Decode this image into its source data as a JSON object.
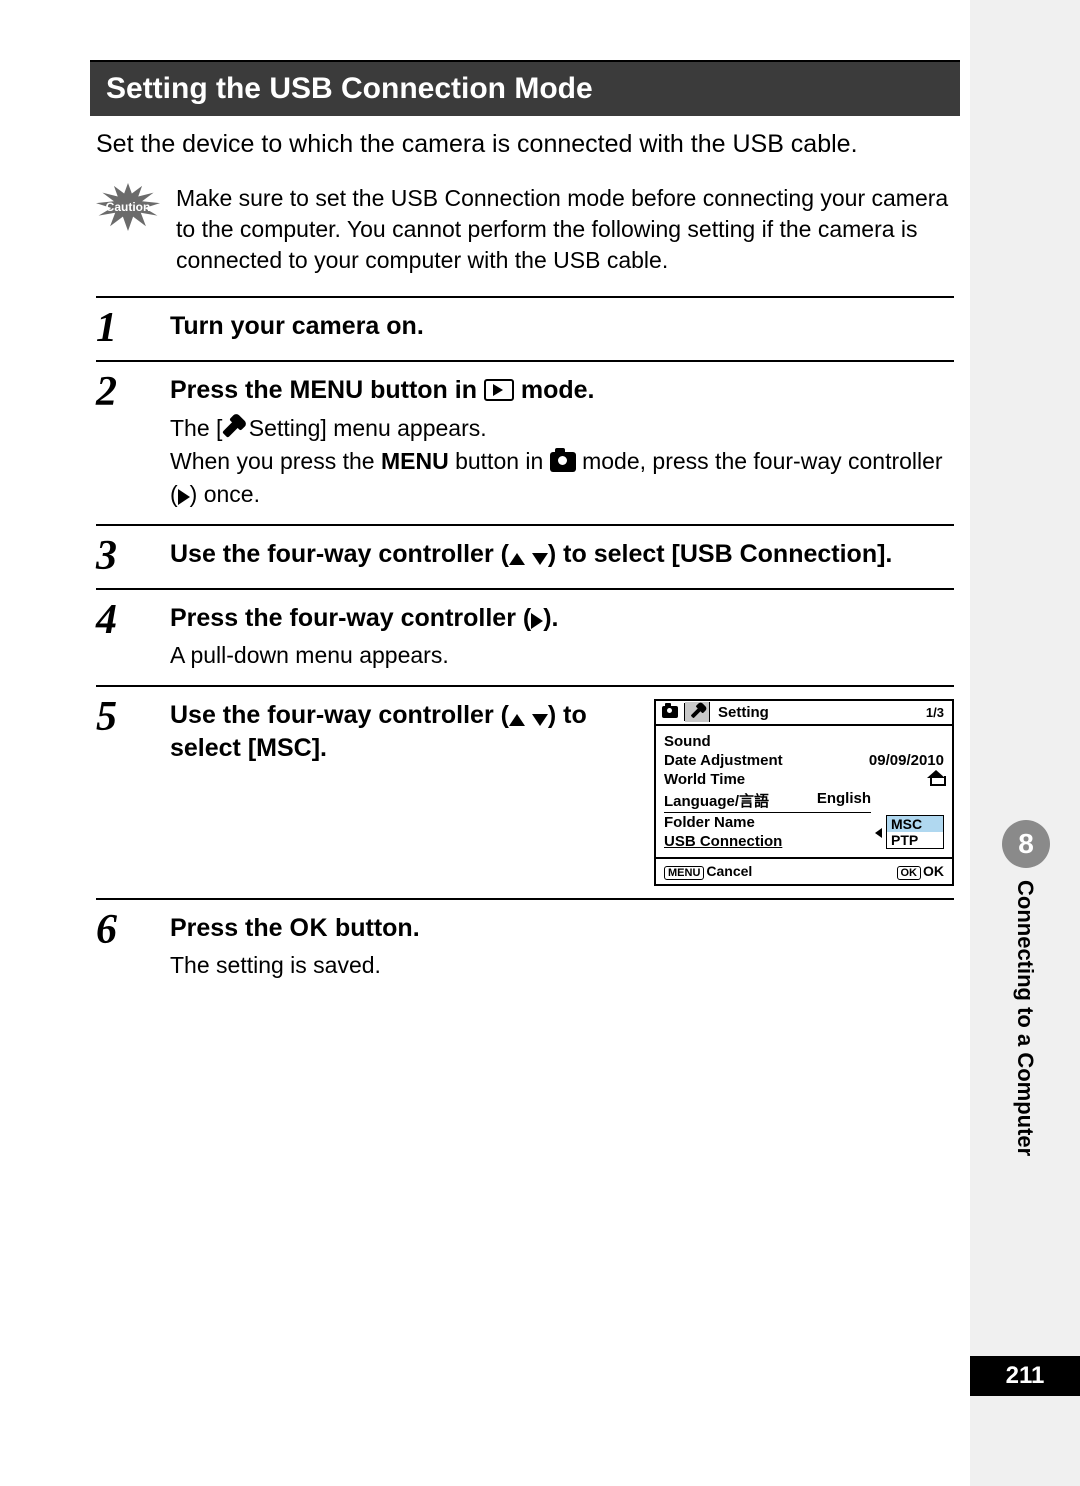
{
  "chapter": {
    "number": "8",
    "title": "Connecting to a Computer"
  },
  "page_number": "211",
  "title": "Setting the USB Connection Mode",
  "intro": "Set the device to which the camera is connected with the USB cable.",
  "caution": {
    "label": "Caution",
    "text": "Make sure to set the USB Connection mode before connecting your camera to the computer. You cannot perform the following setting if the camera is connected to your computer with the USB cable."
  },
  "steps": [
    {
      "num": "1",
      "main_before": "Turn your camera on."
    },
    {
      "num": "2",
      "main_before": "Press the ",
      "main_button": "MENU",
      "main_mid": " button in ",
      "main_after": " mode.",
      "desc_l1a": "The [",
      "desc_l1b": " Setting] menu appears.",
      "desc_l2a": "When you press the ",
      "desc_l2btn": "MENU",
      "desc_l2b": " button in ",
      "desc_l2c": " mode, press the four-way controller (",
      "desc_l2d": ") once."
    },
    {
      "num": "3",
      "main_before": "Use the four-way controller (",
      "main_after": ") to select [USB Connection]."
    },
    {
      "num": "4",
      "main_before": "Press the four-way controller (",
      "main_after": ").",
      "desc": "A pull-down menu appears."
    },
    {
      "num": "5",
      "main_before": "Use the four-way controller (",
      "main_after": ") to select [MSC]."
    },
    {
      "num": "6",
      "main_before": "Press the ",
      "main_button": "OK",
      "main_after": " button.",
      "desc": "The setting is saved."
    }
  ],
  "screen": {
    "header_title": "Setting",
    "header_page": "1/3",
    "rows": [
      {
        "label": "Sound",
        "value": ""
      },
      {
        "label": "Date Adjustment",
        "value": "09/09/2010"
      },
      {
        "label": "World Time",
        "value_icon": "home"
      },
      {
        "label": "Language/言語",
        "value": "English"
      },
      {
        "label": "Folder Name",
        "value": ""
      }
    ],
    "usb_label": "USB Connection",
    "dropdown": {
      "options": [
        "MSC",
        "PTP"
      ],
      "selected": "MSC"
    },
    "footer_menu": "MENU",
    "footer_cancel": "Cancel",
    "footer_ok_btn": "OK",
    "footer_ok": "OK"
  }
}
